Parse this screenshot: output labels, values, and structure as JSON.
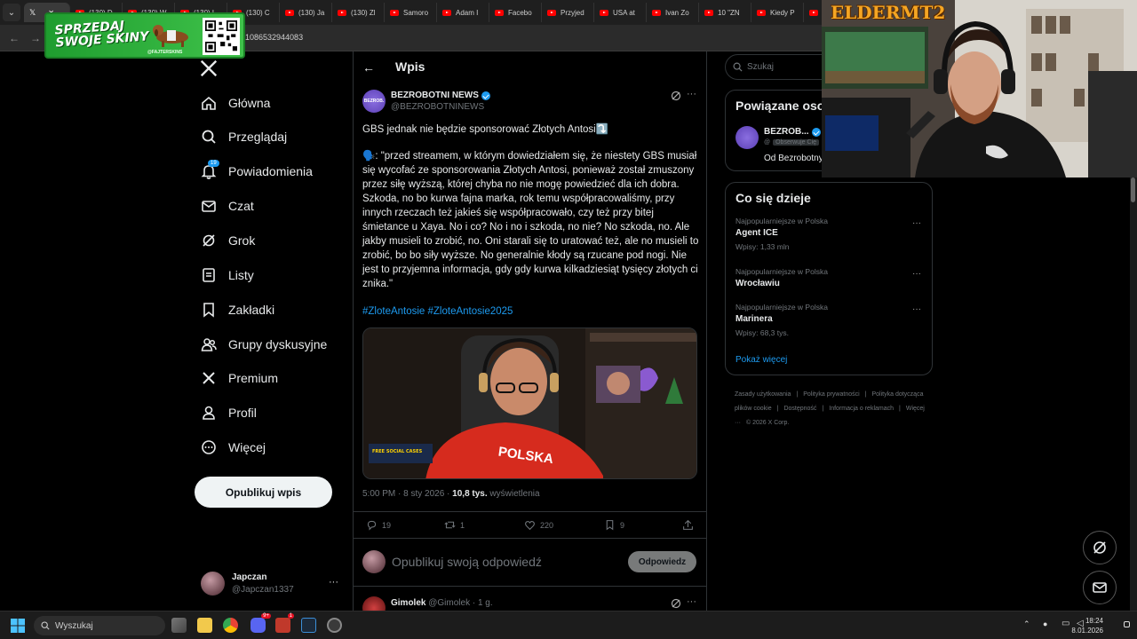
{
  "browser": {
    "tabs": [
      {
        "label": "X",
        "type": "x",
        "active": true
      },
      {
        "label": "(130) D",
        "type": "yt"
      },
      {
        "label": "(130) W",
        "type": "yt"
      },
      {
        "label": "(130) L",
        "type": "yt"
      },
      {
        "label": "(130) C",
        "type": "yt"
      },
      {
        "label": "(130) Ja",
        "type": "yt"
      },
      {
        "label": "(130) Zl",
        "type": "yt"
      },
      {
        "label": "Samoro",
        "type": "yt"
      },
      {
        "label": "Adam I",
        "type": "yt"
      },
      {
        "label": "Facebo",
        "type": "yt"
      },
      {
        "label": "Przyjed",
        "type": "yt"
      },
      {
        "label": "USA at",
        "type": "yt"
      },
      {
        "label": "Ivan Zo",
        "type": "yt"
      },
      {
        "label": "10 \"ZN",
        "type": "yt"
      },
      {
        "label": "Kiedy P",
        "type": "yt"
      },
      {
        "label": "",
        "type": "yt"
      }
    ],
    "url": "1086532944083"
  },
  "promo": {
    "title": "SPRZEDAJ\nSWOJE SKINY",
    "handle": "@FAJTERSKINS"
  },
  "nav": {
    "items": [
      {
        "label": "Główna",
        "icon": "home-icon"
      },
      {
        "label": "Przeglądaj",
        "icon": "search-icon"
      },
      {
        "label": "Powiadomienia",
        "icon": "bell-icon",
        "badge": "19"
      },
      {
        "label": "Czat",
        "icon": "mail-icon"
      },
      {
        "label": "Grok",
        "icon": "grok-icon"
      },
      {
        "label": "Listy",
        "icon": "list-icon"
      },
      {
        "label": "Zakładki",
        "icon": "bookmark-icon"
      },
      {
        "label": "Grupy dyskusyjne",
        "icon": "people-icon"
      },
      {
        "label": "Premium",
        "icon": "x-icon"
      },
      {
        "label": "Profil",
        "icon": "person-icon"
      },
      {
        "label": "Więcej",
        "icon": "more-circle-icon"
      }
    ],
    "post_button": "Opublikuj wpis",
    "account": {
      "name": "Japczan",
      "handle": "@Japczan1337",
      "more": "···"
    }
  },
  "post": {
    "back": "←",
    "header_title": "Wpis",
    "author_name": "BEZROBOTNI NEWS",
    "author_handle": "@BEZROBOTNINEWS",
    "avatar_text": "BEZROB.",
    "more": "···",
    "headline": "GBS jednak nie będzie sponsorować Złotych Antosi⤵️",
    "body": "🗣️: \"przed streamem, w którym dowiedziałem się, że niestety GBS musiał się wycofać ze sponsorowania Złotych Antosi, ponieważ został zmuszony przez siłę wyższą, której chyba no nie mogę powiedzieć dla ich dobra. Szkoda, no bo kurwa fajna marka, rok temu współpracowaliśmy, przy innych rzeczach też jakieś się współpracowało, czy też przy bitej śmietance u Xaya. No i co? No i no i szkoda, no nie? No szkoda, no. Ale jakby musieli to zrobić, no. Oni starali się to uratować też, ale no musieli to zrobić, bo bo siły wyższe. No generalnie kłody są rzucane pod nogi. Nie jest to przyjemna informacja, gdy gdy kurwa kilkadziesiąt tysięcy złotych ci znika.\"",
    "hashtags": "#ZloteAntosie #ZloteAntosie2025",
    "media_shirt_text": "POLSKA",
    "media_sticker": "FREE SOCIAL CASES",
    "time": "5:00 PM · 8 sty 2026 · ",
    "views_count": "10,8 tys.",
    "views_label": " wyświetlenia",
    "actions": {
      "replies": "19",
      "reposts": "1",
      "likes": "220",
      "bookmarks": "9"
    },
    "reply_placeholder": "Opublikuj swoją odpowiedź",
    "reply_button": "Odpowiedz",
    "next_reply": {
      "name": "Gimolek",
      "meta": " @Gimolek · 1 g."
    }
  },
  "sidebar": {
    "search_placeholder": "Szukaj",
    "related_title": "Powiązane oso",
    "related_name": "BEZROB...",
    "related_handle": "@",
    "related_follows": "Obserwuje Cię",
    "related_bio": "Od Bezrobotny",
    "trends_title": "Co się dzieje",
    "trends": [
      {
        "category": "Najpopularniejsze w Polska",
        "name": "Agent ICE",
        "posts": "Wpisy: 1,33 mln"
      },
      {
        "category": "Najpopularniejsze w Polska",
        "name": "Wrocławiu",
        "posts": ""
      },
      {
        "category": "Najpopularniejsze w Polska",
        "name": "Marinera",
        "posts": "Wpisy: 68,3 tys."
      }
    ],
    "show_more": "Pokaż więcej",
    "footer": [
      "Zasady użytkowania",
      "|",
      "Polityka prywatności",
      "|",
      "Polityka dotycząca plików cookie",
      "|",
      "Dostępność",
      "|",
      "Informacja o reklamach",
      "|",
      "Więcej ···",
      "© 2026 X Corp."
    ]
  },
  "overlay": {
    "elder_logo": "ELDERMT2"
  },
  "taskbar": {
    "search": "Wyszukaj",
    "time": "18:24",
    "date": "8.01.2026",
    "discord_badge": "9+",
    "app_badge": "1"
  },
  "colors": {
    "accent": "#1d9bf0",
    "bg": "#000000",
    "border": "#2f3336",
    "muted": "#71767b"
  }
}
